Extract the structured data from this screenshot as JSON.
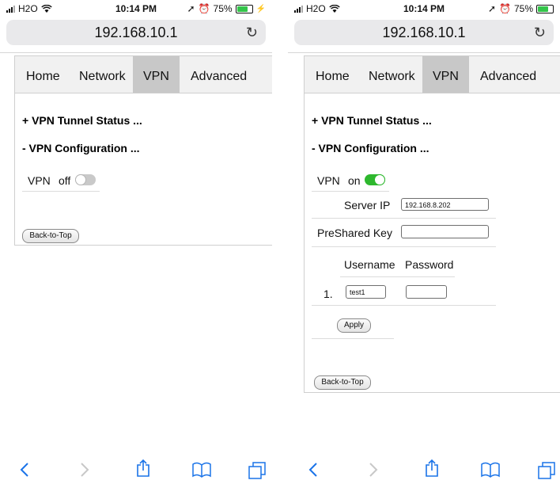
{
  "status": {
    "carrier": "H2O",
    "time": "10:14 PM",
    "battery": "75%"
  },
  "browser": {
    "url": "192.168.10.1"
  },
  "nav": {
    "tabs": [
      "Home",
      "Network",
      "VPN",
      "Advanced"
    ],
    "active": "VPN"
  },
  "sections": {
    "tunnel_status": "+ VPN Tunnel Status ...",
    "configuration": "- VPN Configuration ..."
  },
  "left": {
    "vpn_label": "VPN",
    "vpn_state": "off",
    "back_to_top": "Back-to-Top"
  },
  "right": {
    "vpn_label": "VPN",
    "vpn_state": "on",
    "server_ip_label": "Server IP",
    "server_ip_value": "192.168.8.202",
    "preshared_key_label": "PreShared Key",
    "preshared_key_value": "",
    "users_header": {
      "username": "Username",
      "password": "Password"
    },
    "users": [
      {
        "index": "1.",
        "username": "test1",
        "password": ""
      }
    ],
    "apply_button": "Apply",
    "back_to_top": "Back-to-Top"
  },
  "colors": {
    "toggle_on": "#2eb82e",
    "toggle_off": "#c9c9c9",
    "toolbar_accent": "#1a73e8",
    "active_tab": "#c8c8c8"
  },
  "icons": [
    "signal-icon",
    "wifi-icon",
    "location-icon",
    "alarm-icon",
    "battery-icon",
    "charging-icon",
    "reload-icon",
    "back-icon",
    "forward-icon",
    "share-icon",
    "bookmarks-icon",
    "tabs-icon"
  ]
}
